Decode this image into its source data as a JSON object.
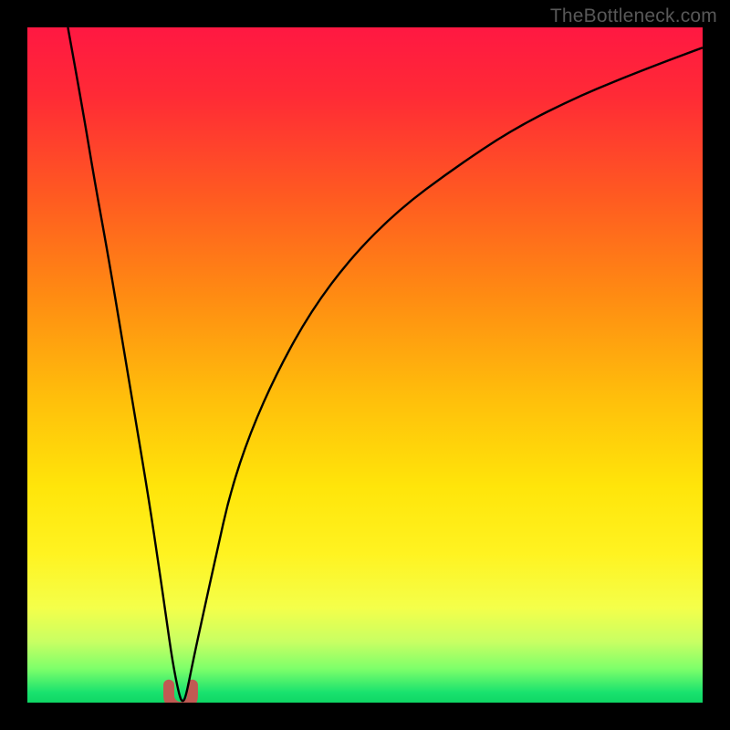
{
  "watermark": "TheBottleneck.com",
  "chart_data": {
    "type": "line",
    "title": "",
    "xlabel": "",
    "ylabel": "",
    "xlim": [
      0,
      1
    ],
    "ylim": [
      0,
      100
    ],
    "x_min_fraction": 0.227,
    "gradient_stops": [
      {
        "offset": 0.0,
        "color": "#ff1842"
      },
      {
        "offset": 0.1,
        "color": "#ff2a36"
      },
      {
        "offset": 0.25,
        "color": "#ff5a21"
      },
      {
        "offset": 0.4,
        "color": "#ff8c12"
      },
      {
        "offset": 0.55,
        "color": "#ffbf0b"
      },
      {
        "offset": 0.68,
        "color": "#ffe50a"
      },
      {
        "offset": 0.78,
        "color": "#fff321"
      },
      {
        "offset": 0.86,
        "color": "#f4ff4a"
      },
      {
        "offset": 0.91,
        "color": "#c8ff63"
      },
      {
        "offset": 0.95,
        "color": "#7dff6a"
      },
      {
        "offset": 0.985,
        "color": "#19e26e"
      },
      {
        "offset": 1.0,
        "color": "#0fd665"
      }
    ],
    "series": [
      {
        "name": "bottleneck-curve",
        "x": [
          0.06,
          0.08,
          0.1,
          0.12,
          0.14,
          0.16,
          0.18,
          0.195,
          0.205,
          0.215,
          0.225,
          0.23,
          0.235,
          0.245,
          0.26,
          0.28,
          0.3,
          0.33,
          0.37,
          0.42,
          0.48,
          0.55,
          0.63,
          0.72,
          0.82,
          0.92,
          1.0
        ],
        "values": [
          100,
          89,
          77,
          66,
          54,
          42,
          30,
          20,
          13,
          6,
          1,
          0,
          1,
          6,
          13,
          22,
          31,
          40,
          49,
          58,
          66,
          73,
          79,
          85,
          90,
          94,
          97
        ]
      }
    ],
    "minimum_marker": {
      "name": "lowest-point-arc",
      "color": "#c15a53",
      "stroke_width": 12,
      "x_center": 0.227,
      "y_top": 2.6,
      "y_bottom": 0.0,
      "width_fraction": 0.035
    }
  }
}
